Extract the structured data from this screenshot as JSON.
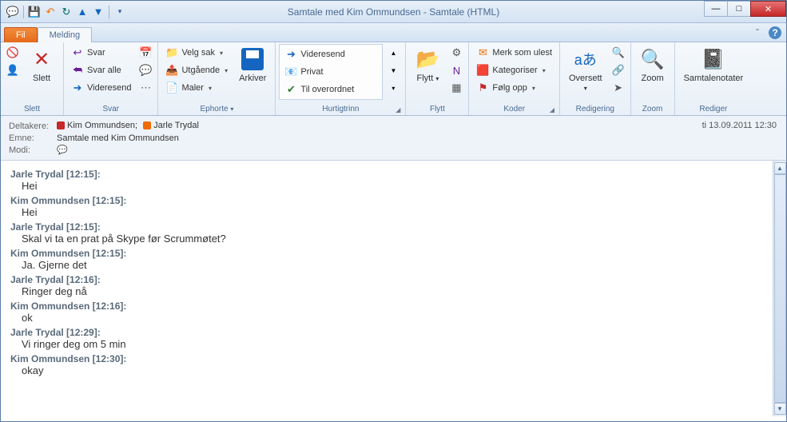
{
  "window": {
    "title": "Samtale med Kim Ommundsen  -  Samtale (HTML)"
  },
  "tabs": {
    "fil": "Fil",
    "melding": "Melding"
  },
  "ribbon": {
    "slett": {
      "group": "Slett",
      "slett": "Slett"
    },
    "svar": {
      "group": "Svar",
      "svar": "Svar",
      "svar_alle": "Svar alle",
      "videresend": "Videresend"
    },
    "ephorte": {
      "group": "Ephorte",
      "velg_sak": "Velg sak",
      "utgaende": "Utgående",
      "maler": "Maler",
      "arkiver": "Arkiver"
    },
    "hurtigtrinn": {
      "group": "Hurtigtrinn",
      "videresend": "Videresend",
      "privat": "Privat",
      "til_overordnet": "Til overordnet"
    },
    "flytt": {
      "group": "Flytt",
      "flytt": "Flytt"
    },
    "koder": {
      "group": "Koder",
      "merk_ulest": "Merk som ulest",
      "kategoriser": "Kategoriser",
      "folg_opp": "Følg opp"
    },
    "redigering": {
      "group": "Redigering",
      "oversett": "Oversett"
    },
    "zoom": {
      "group": "Zoom",
      "zoom": "Zoom"
    },
    "rediger": {
      "group": "Rediger",
      "notater": "Samtalenotater"
    }
  },
  "header": {
    "deltakere_label": "Deltakere:",
    "emne_label": "Emne:",
    "modi_label": "Modi:",
    "participants": [
      {
        "name": "Kim Ommundsen;",
        "presence": "busy"
      },
      {
        "name": "Jarle Trydal",
        "presence": "away"
      }
    ],
    "emne": "Samtale med Kim Ommundsen",
    "timestamp": "ti 13.09.2011 12:30"
  },
  "messages": [
    {
      "sender": "Jarle Trydal",
      "time": "[12:15]",
      "text": "Hei"
    },
    {
      "sender": "Kim Ommundsen",
      "time": "[12:15]",
      "text": "Hei"
    },
    {
      "sender": "Jarle Trydal",
      "time": "[12:15]",
      "text": "Skal vi ta en prat på Skype før Scrummøtet?"
    },
    {
      "sender": "Kim Ommundsen",
      "time": "[12:15]",
      "text": "Ja. Gjerne det"
    },
    {
      "sender": "Jarle Trydal",
      "time": "[12:16]",
      "text": "Ringer deg nå"
    },
    {
      "sender": "Kim Ommundsen",
      "time": "[12:16]",
      "text": "ok"
    },
    {
      "sender": "Jarle Trydal",
      "time": "[12:29]",
      "text": "Vi ringer deg om 5 min"
    },
    {
      "sender": "Kim Ommundsen",
      "time": "[12:30]",
      "text": "okay"
    }
  ]
}
